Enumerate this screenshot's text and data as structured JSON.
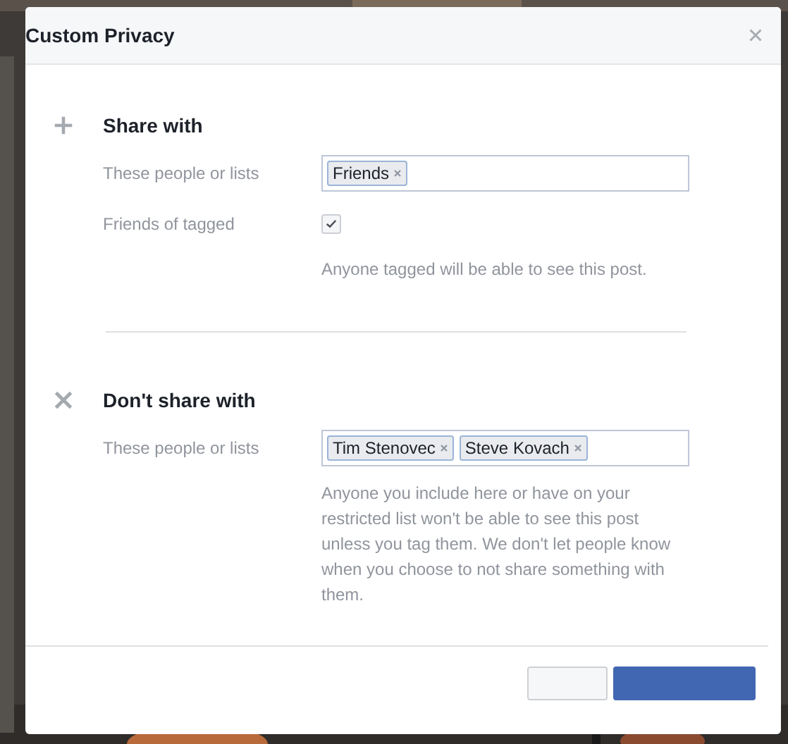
{
  "dialog": {
    "title": "Custom Privacy",
    "sections": [
      {
        "kind": "include",
        "heading": "Share with",
        "field_label": "These people or lists",
        "tokens": [
          "Friends"
        ],
        "option": {
          "label": "Friends of tagged",
          "checked": true
        },
        "help": "Anyone tagged will be able to see this post."
      },
      {
        "kind": "exclude",
        "heading": "Don't share with",
        "field_label": "These people or lists",
        "tokens": [
          "Tim Stenovec",
          "Steve Kovach"
        ],
        "help": "Anyone you include here or have on your restricted list won't be able to see this post unless you tag them. We don't let people know when you choose to not share something with them."
      }
    ]
  }
}
